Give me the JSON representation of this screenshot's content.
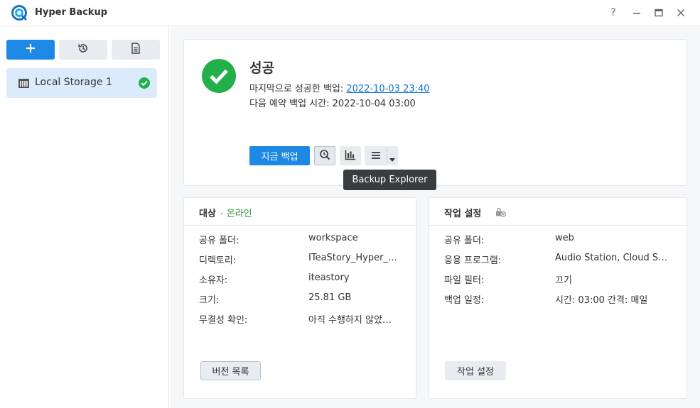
{
  "app": {
    "title": "Hyper Backup",
    "icon": "hyper-backup-icon"
  },
  "window_controls": {
    "help": "?",
    "icons": [
      "help-icon",
      "minimize-icon",
      "maximize-icon",
      "close-icon"
    ]
  },
  "sidebar": {
    "buttons": [
      "plus-icon",
      "restore-history-icon",
      "log-document-icon"
    ],
    "items": [
      {
        "label": "Local Storage 1",
        "icon": "storage-icon",
        "status_icon": "success-check-icon"
      }
    ]
  },
  "status": {
    "title": "성공",
    "last_backup_label": "마지막으로 성공한 백업: ",
    "last_backup_value": "2022-10-03 23:40",
    "next_backup": "다음 예약 백업 시간: 2022-10-04 03:00",
    "backup_now_label": "지금 백업",
    "tools": [
      "backup-explorer-icon",
      "statistics-icon",
      "menu-icon"
    ],
    "tooltip": "Backup Explorer"
  },
  "target_panel": {
    "title": "대상",
    "status": "- 온라인",
    "rows": [
      {
        "label": "공유 폴더:",
        "value": "workspace"
      },
      {
        "label": "디렉토리:",
        "value": "ITeaStory_Hyper_…"
      },
      {
        "label": "소유자:",
        "value": "iteastory"
      },
      {
        "label": "크기:",
        "value": "25.81 GB"
      },
      {
        "label": "무결성 확인:",
        "value": "아직 수행하지 않았…"
      }
    ],
    "button": "버전 목록"
  },
  "task_panel": {
    "title": "작업 설정",
    "title_icon": "lock-settings-icon",
    "rows": [
      {
        "label": "공유 폴더:",
        "value": "web"
      },
      {
        "label": "응용 프로그램:",
        "value": "Audio Station, Cloud S…"
      },
      {
        "label": "파일 필터:",
        "value": "끄기"
      },
      {
        "label": "백업 일정:",
        "value": "시간: 03:00 간격: 매일"
      }
    ],
    "button": "작업 설정"
  },
  "colors": {
    "primary": "#1e88e5",
    "success": "#22b04b",
    "online": "#2e9a3c",
    "selected_bg": "#dcebfb"
  }
}
